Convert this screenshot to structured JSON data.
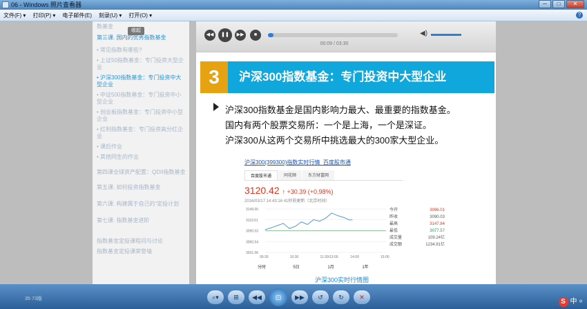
{
  "window": {
    "title": "06 - Windows 照片查看器",
    "buttons": [
      "─",
      "□",
      "✕"
    ]
  },
  "menu": [
    "文件(F) ▾",
    "打印(P) ▾",
    "电子邮件(E)",
    "刻录(U) ▾",
    "打开(O) ▾"
  ],
  "help_icon": "?",
  "sidebar": {
    "collapse": "收起",
    "top": "数基金",
    "lesson3": "第三课. 国内的优秀指数基金",
    "items": [
      "常见指数有哪些?",
      "上证50指数基金：专门投资大型企业",
      "沪深300指数基金：专门投资中大型企业",
      "中证500指数基金：专门投资中小型企业",
      "创业板指数基金：专门投资中小型企业",
      "红利指数基金：专门投资高分红企业",
      "课后作业",
      "其他同生的作业"
    ],
    "lesson4": "第四课全球资产配置：QDII指数基金",
    "lesson5": "第五课. 如何投资指数基金",
    "lesson6": "第六课. 构建属于自己的“定投计划",
    "lesson7": "第七课. 指数基金进阶",
    "footer1": "指数基金定投课程问与讨论",
    "footer2": "指数基金定投课荣誉墙"
  },
  "player": {
    "controls": [
      "◀◀",
      "❚❚",
      "▶▶",
      "■"
    ],
    "progress": 0.04,
    "time": "00:09 / 03:30",
    "volume_icon": "◀)"
  },
  "slide": {
    "number": "3",
    "title": "沪深300指数基金：专门投资中大型企业",
    "lines": [
      "沪深300指数基金是国内影响力最大、最重要的指数基金。",
      "国内有两个股票交易所：一个是上海，一个是深证。",
      "沪深300从这两个交易所中挑选最大的300家大型企业。"
    ]
  },
  "card": {
    "link": "沪深300(399300)指数实时行情_百度股市通",
    "tabs": [
      "百度股市通",
      "同花顺",
      "东方财富网"
    ],
    "price": "3120.42",
    "change": "↑ +30.39 (+0.98%)",
    "timestamp": "2016/03/17 14:43:16  41秒前更新（北京时间）",
    "stats": [
      [
        "今开",
        "3096.01"
      ],
      [
        "昨收",
        "3090.03"
      ],
      [
        "最高",
        "3147.84"
      ],
      [
        "最低",
        "3077.57"
      ],
      [
        "成交量",
        "109.24亿"
      ],
      [
        "成交额",
        "1234.91亿"
      ]
    ],
    "periods": [
      "分时",
      "5日",
      "1月",
      "1年"
    ],
    "caption": "沪深300实时行情图",
    "colors": {
      "up": "#e0351e",
      "down": "#1a9a4c",
      "line": "#3d8fd6"
    }
  },
  "chart_data": {
    "type": "line",
    "yticks": [
      "3149.00",
      "3119.51",
      "3090.03",
      "3060.54",
      "3031.06"
    ],
    "xticks": [
      "09:30",
      "10:30",
      "11:30/13:00",
      "14:00",
      "15:00"
    ],
    "ylim": [
      3031.06,
      3149.0
    ],
    "x": [
      0,
      0.05,
      0.1,
      0.15,
      0.2,
      0.25,
      0.3,
      0.35,
      0.4,
      0.45,
      0.5,
      0.55,
      0.6,
      0.65,
      0.7,
      0.72
    ],
    "values": [
      3093,
      3098,
      3104,
      3110,
      3096,
      3102,
      3114,
      3107,
      3120,
      3116,
      3124,
      3138,
      3131,
      3126,
      3119,
      3120
    ]
  },
  "taskbar": {
    "buttons": [
      "⌕▾",
      "⊞",
      "◀◀",
      "▢",
      "▶▶",
      "↺",
      "↻",
      "✕"
    ],
    "left": "35·73版",
    "tray": "中 ⸰"
  }
}
